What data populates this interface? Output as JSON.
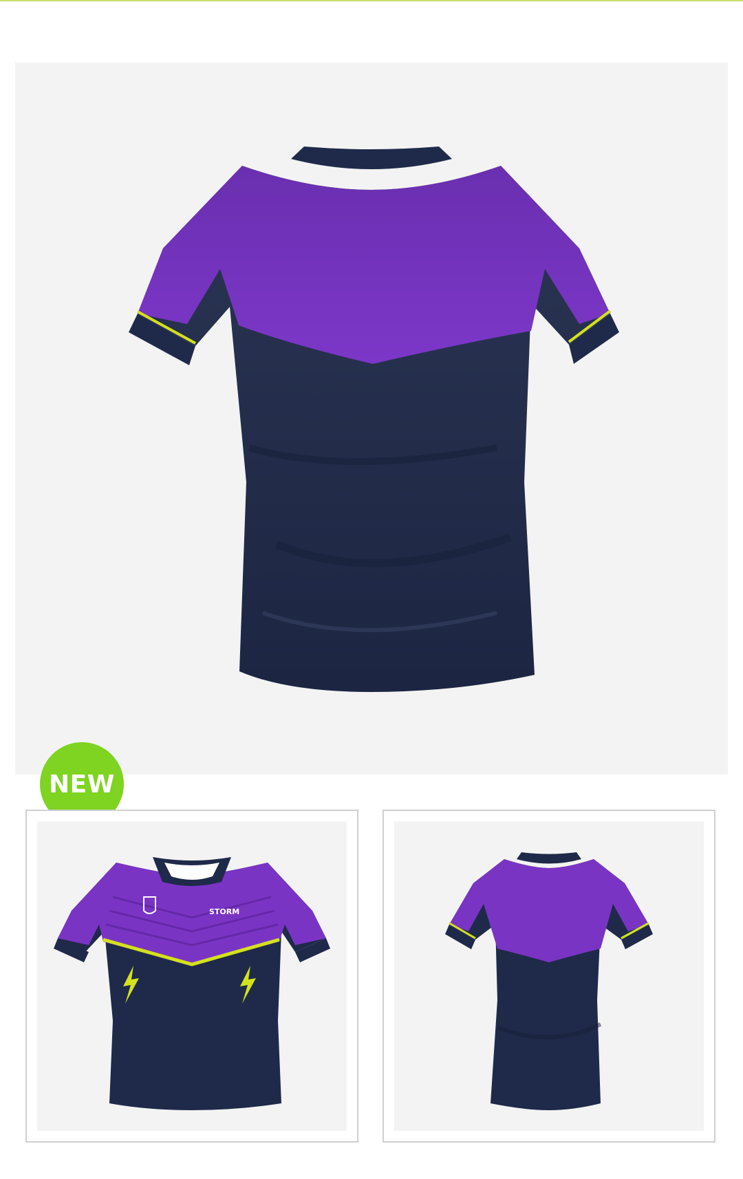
{
  "product": {
    "badge": "NEW",
    "main_image": {
      "view": "back",
      "icon": "jersey-back-image"
    },
    "thumbnails": [
      {
        "view": "front",
        "icon": "jersey-front-image",
        "crest_text": "STORM"
      },
      {
        "view": "back",
        "icon": "jersey-back-image"
      }
    ]
  },
  "colors": {
    "purple": "#7a34c4",
    "navy": "#1f2a4a",
    "trim_yellow": "#d4e21c",
    "badge_green": "#7fd321",
    "background": "#f3f3f3"
  }
}
